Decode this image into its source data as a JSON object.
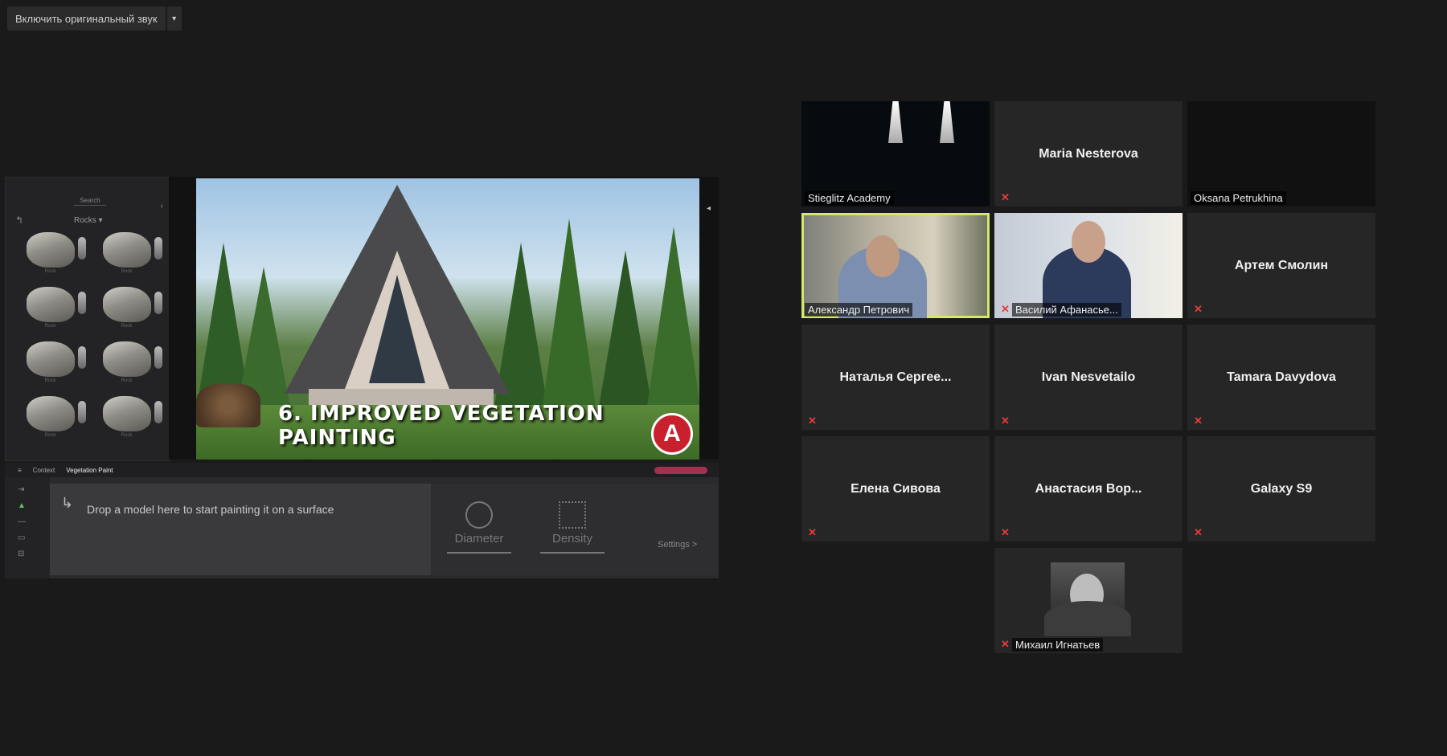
{
  "topbar": {
    "audio_button_label": "Включить оригинальный звук",
    "audio_arrow": "▾"
  },
  "shared_screen": {
    "left_panel": {
      "search_label": "Search",
      "category": "Rocks ▾",
      "back_icon": "↰",
      "close_icon": "‹",
      "item_label": "Rock"
    },
    "video_caption": "6. IMPROVED VEGETATION PAINTING",
    "logo_letter": "A",
    "bottom_panel": {
      "tabs": [
        "Context",
        "Vegetation Paint"
      ],
      "drop_icon": "↳",
      "drop_text": "Drop a model here to start painting it on a surface",
      "diameter_label": "Diameter",
      "density_label": "Density",
      "settings_label": "Settings >"
    }
  },
  "participants": [
    {
      "name": "Stieglitz Academy",
      "type": "video",
      "muted": false
    },
    {
      "name": "Maria Nesterova",
      "type": "name",
      "muted": true
    },
    {
      "name": "Oksana Petrukhina",
      "type": "video",
      "muted": false
    },
    {
      "name": "Александр Петрович",
      "type": "video",
      "muted": false,
      "active_speaker": true
    },
    {
      "name": "Василий Афанасье...",
      "type": "video",
      "muted": true
    },
    {
      "name": "Артем Смолин",
      "type": "name",
      "muted": true
    },
    {
      "name": "Наталья  Сергее...",
      "type": "name",
      "muted": true
    },
    {
      "name": "Ivan Nesvetailo",
      "type": "name",
      "muted": true
    },
    {
      "name": "Tamara Davydova",
      "type": "name",
      "muted": true
    },
    {
      "name": "Елена Сивова",
      "type": "name",
      "muted": true
    },
    {
      "name": "Анастасия  Вор...",
      "type": "name",
      "muted": true
    },
    {
      "name": "Galaxy S9",
      "type": "name",
      "muted": true
    },
    {
      "name": "Михаил Игнатьев",
      "type": "avatar",
      "muted": true
    }
  ],
  "colors": {
    "background": "#1a1a1a",
    "tile": "#262626",
    "active_speaker_border": "#d6e86a",
    "muted_icon": "#e43d3d"
  },
  "icons": {
    "muted": "mic-off-icon"
  }
}
